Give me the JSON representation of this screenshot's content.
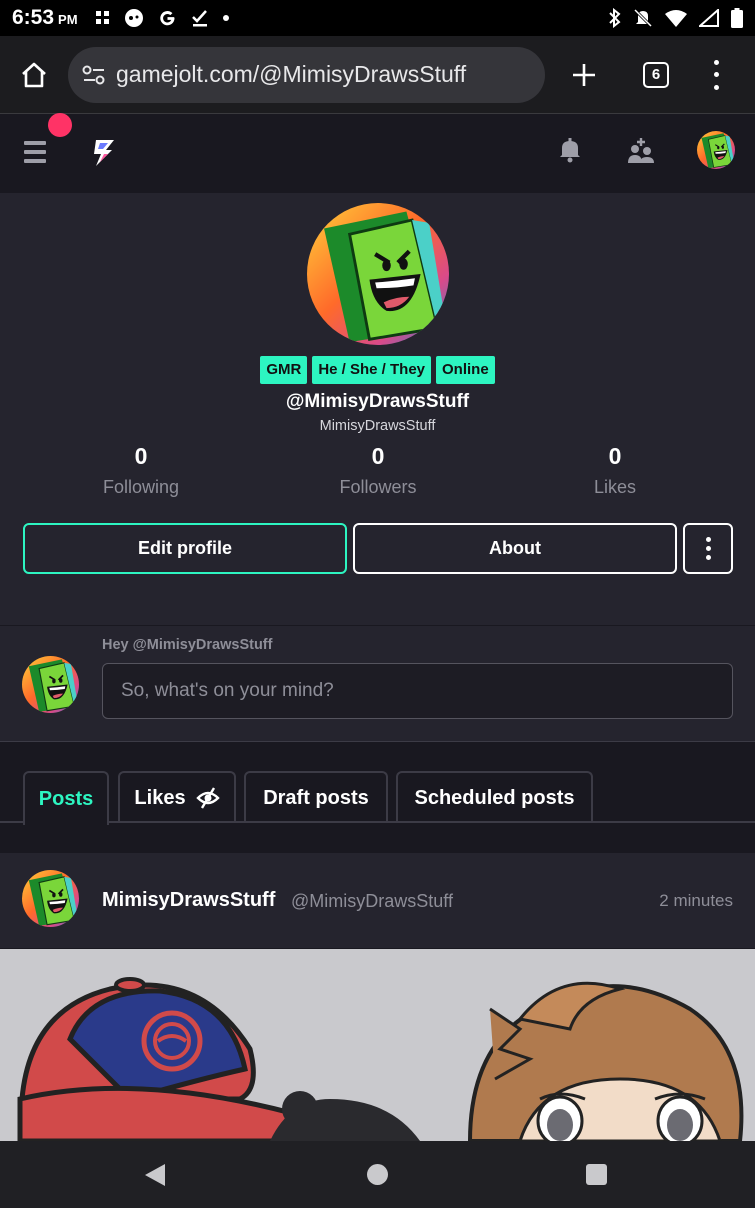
{
  "status_bar": {
    "time": "6:53",
    "ampm": "PM"
  },
  "browser": {
    "url": "gamejolt.com/@MimisyDrawsStuff",
    "tab_count": "6"
  },
  "profile": {
    "tags": [
      "GMR",
      "He / She / They",
      "Online"
    ],
    "handle": "@MimisyDrawsStuff",
    "display_name": "MimisyDrawsStuff",
    "stats": [
      {
        "value": "0",
        "label": "Following"
      },
      {
        "value": "0",
        "label": "Followers"
      },
      {
        "value": "0",
        "label": "Likes"
      }
    ],
    "edit_label": "Edit profile",
    "about_label": "About"
  },
  "composer": {
    "greeting": "Hey @MimisyDrawsStuff",
    "placeholder": "So, what's on your mind?"
  },
  "tabs": [
    {
      "label": "Posts"
    },
    {
      "label": "Likes"
    },
    {
      "label": "Draft posts"
    },
    {
      "label": "Scheduled posts"
    }
  ],
  "post": {
    "author": "MimisyDrawsStuff",
    "handle": "@MimisyDrawsStuff",
    "time": "2 minutes"
  },
  "colors": {
    "accent": "#2df5c1",
    "notification": "#ff3366",
    "background": "#191820",
    "panel": "#25242e"
  }
}
